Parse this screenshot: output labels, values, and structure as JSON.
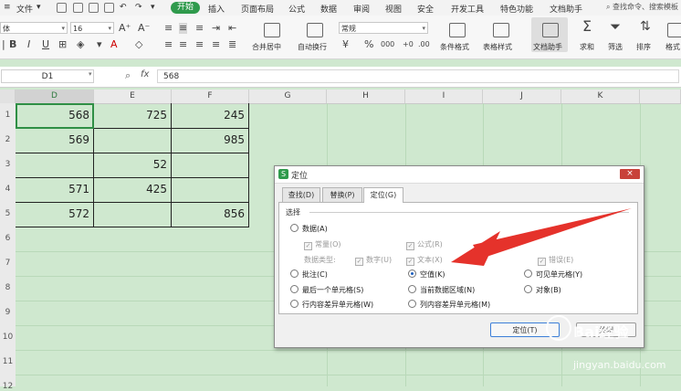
{
  "menubar": {
    "file_label": "文件",
    "tabs": [
      "开始",
      "插入",
      "页面布局",
      "公式",
      "数据",
      "审阅",
      "视图",
      "安全",
      "开发工具",
      "特色功能",
      "文档助手"
    ],
    "search_placeholder": "查找命令、搜索模板"
  },
  "ribbon": {
    "font_name": "体",
    "font_size": "16",
    "number_format": "常规",
    "labels": {
      "merge_center": "合并居中",
      "wrap_text": "自动换行",
      "cond_format": "条件格式",
      "table_style": "表格样式",
      "doc_helper": "文档助手",
      "sum": "求和",
      "filter": "筛选",
      "sort": "排序",
      "format": "格式"
    },
    "glyphs": {
      "bold": "B",
      "italic": "I",
      "underline": "U",
      "percent": "%",
      "currency": "¥",
      "sum": "Σ"
    }
  },
  "formula_bar": {
    "name_box": "D1",
    "fx_label": "fx",
    "value": "568"
  },
  "grid": {
    "columns": [
      "D",
      "E",
      "F",
      "G",
      "H",
      "I",
      "J",
      "K"
    ],
    "rows": [
      "1",
      "2",
      "3",
      "4",
      "5",
      "6",
      "7",
      "8",
      "9",
      "10",
      "11",
      "12"
    ],
    "cells": {
      "d1": "568",
      "e1": "725",
      "f1": "245",
      "d2": "569",
      "f2": "985",
      "e3": "52",
      "d4": "571",
      "e4": "425",
      "d5": "572",
      "f5": "856"
    }
  },
  "dialog": {
    "title": "定位",
    "close": "×",
    "tabs": [
      "查找(D)",
      "替换(P)",
      "定位(G)"
    ],
    "section_label": "选择",
    "options": {
      "data": "数据(A)",
      "constant": "常量(O)",
      "formula": "公式(R)",
      "data_type": "数据类型:",
      "number": "数字(U)",
      "text": "文本(X)",
      "error": "错误(E)",
      "comment": "批注(C)",
      "blank": "空值(K)",
      "visible_cells": "可见单元格(Y)",
      "last_cell": "最后一个单元格(S)",
      "current_region": "当前数据区域(N)",
      "object": "对象(B)",
      "row_diff": "行内容差异单元格(W)",
      "col_diff": "列内容差异单元格(M)"
    },
    "buttons": {
      "ok": "定位(T)",
      "close": "关闭"
    }
  },
  "watermark": {
    "brand": "Bai经验",
    "url": "jingyan.baidu.com"
  },
  "colors": {
    "accent": "#2f9a4c",
    "sheet_bg": "#cfe8cf",
    "arrow": "#e5322b"
  }
}
